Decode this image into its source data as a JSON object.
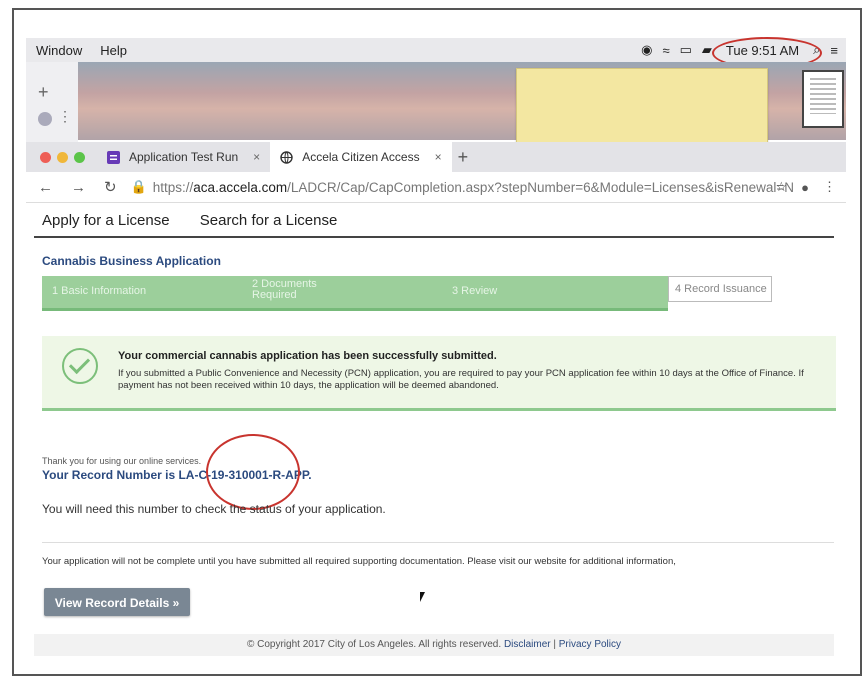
{
  "menubar": {
    "items": [
      "Window",
      "Help"
    ],
    "clock": "Tue 9:51 AM"
  },
  "browser": {
    "tabs": [
      {
        "label": "Application Test Run",
        "active": false
      },
      {
        "label": "Accela Citizen Access",
        "active": true
      }
    ],
    "close_glyph": "×",
    "url": {
      "protocol": "https://",
      "host": "aca.accela.com",
      "path": "/LADCR/Cap/CapCompletion.aspx?stepNumber=6&Module=Licenses&isRenewal=N"
    }
  },
  "site": {
    "nav": [
      "Apply for a License",
      "Search for a License"
    ],
    "app_title": "Cannabis Business Application",
    "steps": [
      "1 Basic Information",
      "2 Documents Required",
      "3 Review",
      "4 Record Issuance"
    ],
    "success_heading": "Your commercial cannabis application has been successfully submitted.",
    "success_body": "If you submitted a Public Convenience and Necessity (PCN) application, you are required to pay your PCN application fee within 10 days at the Office of Finance. If payment has not been received within 10 days, the application will be deemed abandoned.",
    "thanks": "Thank you for using our online services.",
    "record_number": "Your Record Number is LA-C-19-310001-R-APP.",
    "need_number": "You will need this number to check the status of your application.",
    "incomplete": "Your application will not be complete until you have submitted all required supporting documentation.  Please visit our website for additional information,",
    "view_button": "View Record Details »",
    "footer": {
      "copyright": "© Copyright 2017 City of Los Angeles. All rights reserved.",
      "disclaimer": "Disclaimer",
      "privacy": "Privacy Policy"
    }
  },
  "colors": {
    "accent": "#2b4a7f",
    "success": "#8ec98e",
    "annotation": "#c8342e"
  }
}
